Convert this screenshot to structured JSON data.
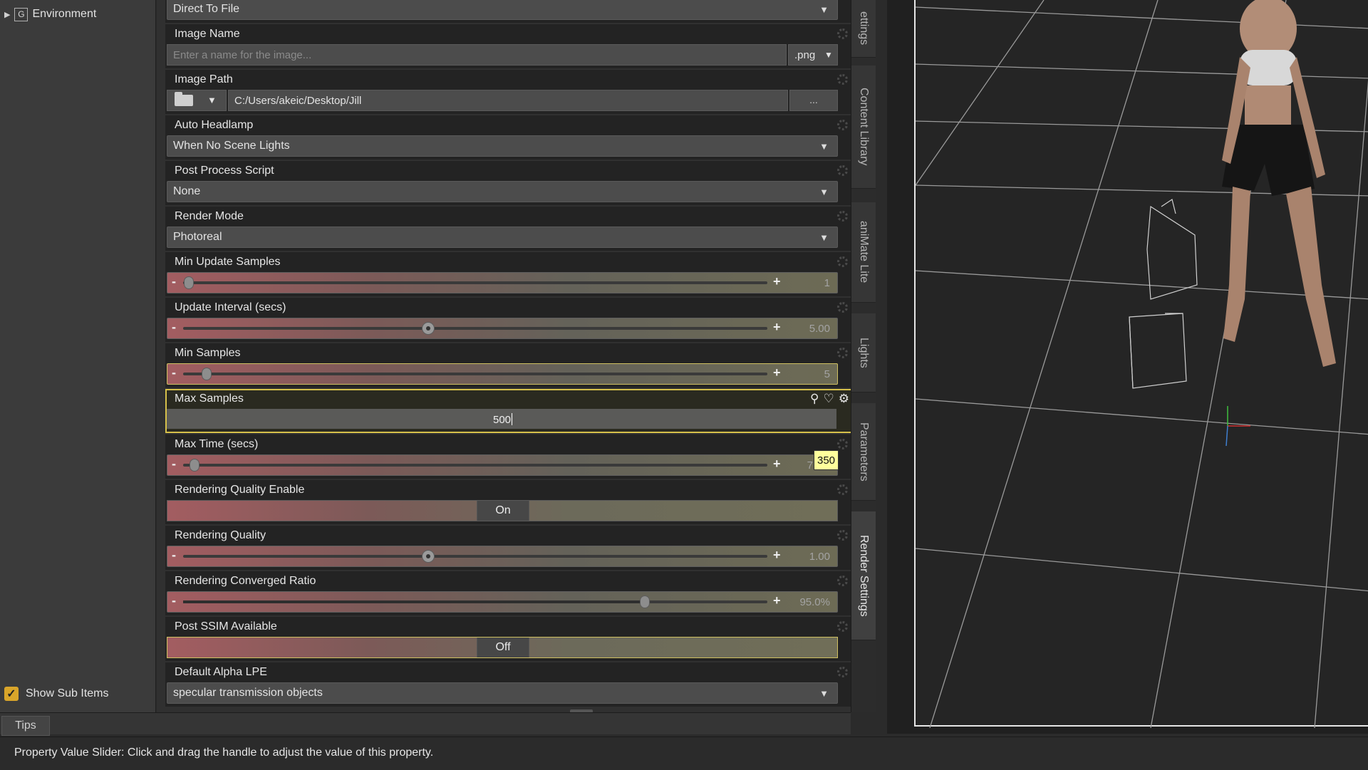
{
  "tree": {
    "item": "Environment",
    "item_icon_letter": "G",
    "show_sub_label": "Show Sub Items",
    "show_sub_checked": true
  },
  "props": {
    "direct": {
      "value": "Direct To File"
    },
    "image_name": {
      "label": "Image Name",
      "placeholder": "Enter a name for the image...",
      "ext": ".png"
    },
    "image_path": {
      "label": "Image Path",
      "value": "C:/Users/akeic/Desktop/Jill",
      "browse": "..."
    },
    "auto_headlamp": {
      "label": "Auto Headlamp",
      "value": "When No Scene Lights"
    },
    "post_process": {
      "label": "Post Process Script",
      "value": "None"
    },
    "render_mode": {
      "label": "Render Mode",
      "value": "Photoreal"
    },
    "min_update": {
      "label": "Min Update Samples",
      "value": "1",
      "fraction": 0.01
    },
    "update_interval": {
      "label": "Update Interval (secs)",
      "value": "5.00",
      "fraction": 0.42
    },
    "min_samples": {
      "label": "Min Samples",
      "value": "5",
      "fraction": 0.04
    },
    "max_samples": {
      "label": "Max Samples",
      "value": "500"
    },
    "max_time": {
      "label": "Max Time (secs)",
      "value": "7",
      "fraction": 0.02,
      "tooltip": "350"
    },
    "rq_enable": {
      "label": "Rendering Quality Enable",
      "value": "On"
    },
    "rq": {
      "label": "Rendering Quality",
      "value": "1.00",
      "fraction": 0.42
    },
    "rcr": {
      "label": "Rendering Converged Ratio",
      "value": "95.0%",
      "fraction": 0.79
    },
    "post_ssim": {
      "label": "Post SSIM Available",
      "value": "Off"
    },
    "alpha_lpe": {
      "label": "Default Alpha LPE",
      "value": "specular transmission objects"
    }
  },
  "side_tabs": {
    "settings": "ettings",
    "content": "Content Library",
    "animate": "aniMate Lite",
    "lights": "Lights",
    "parameters": "Parameters",
    "render": "Render Settings"
  },
  "bottom": {
    "tips": "Tips"
  },
  "status": {
    "text": "Property Value Slider: Click and drag the handle to adjust the value of this property."
  }
}
